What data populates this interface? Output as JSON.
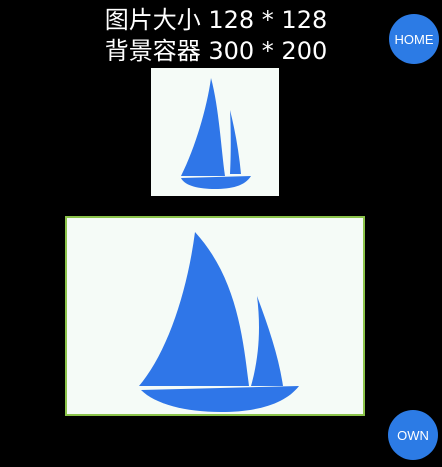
{
  "caption": {
    "line1": "图片大小 128 * 128",
    "line2": "背景容器 300 * 200"
  },
  "buttons": {
    "home": "HOME",
    "own": "OWN"
  },
  "images": {
    "small": "sailboat-icon",
    "large": "sailboat-icon"
  },
  "colors": {
    "background": "#000000",
    "accent": "#2c7be5",
    "container_border": "#8bc34a",
    "image_background": "#f5fbf7",
    "sail": "#2f76e8"
  }
}
